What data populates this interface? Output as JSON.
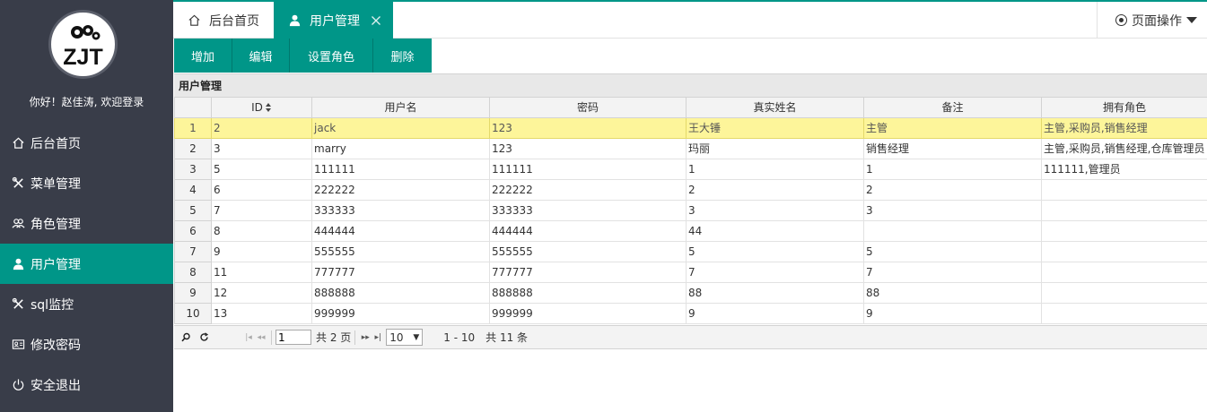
{
  "sidebar": {
    "welcome": "你好！赵佳涛, 欢迎登录",
    "logo_text": "ZJT",
    "items": [
      {
        "label": "后台首页",
        "icon": "home-icon"
      },
      {
        "label": "菜单管理",
        "icon": "tools-icon"
      },
      {
        "label": "角色管理",
        "icon": "users-icon"
      },
      {
        "label": "用户管理",
        "icon": "user-icon",
        "active": true
      },
      {
        "label": "sql监控",
        "icon": "tools-icon"
      },
      {
        "label": "修改密码",
        "icon": "id-card-icon"
      },
      {
        "label": "安全退出",
        "icon": "power-icon"
      }
    ]
  },
  "tabs": {
    "home": "后台首页",
    "user": "用户管理",
    "page_ops": "页面操作"
  },
  "toolbar": {
    "add": "增加",
    "edit": "编辑",
    "set_role": "设置角色",
    "delete": "删除"
  },
  "grid": {
    "title": "用户管理",
    "columns": [
      "ID",
      "用户名",
      "密码",
      "真实姓名",
      "备注",
      "拥有角色"
    ],
    "rows": [
      [
        "1",
        "2",
        "jack",
        "123",
        "王大锤",
        "主管",
        "主管,采购员,销售经理"
      ],
      [
        "2",
        "3",
        "marry",
        "123",
        "玛丽",
        "销售经理",
        "主管,采购员,销售经理,仓库管理员"
      ],
      [
        "3",
        "5",
        "111111",
        "111111",
        "1",
        "1",
        "111111,管理员"
      ],
      [
        "4",
        "6",
        "222222",
        "222222",
        "2",
        "2",
        ""
      ],
      [
        "5",
        "7",
        "333333",
        "333333",
        "3",
        "3",
        ""
      ],
      [
        "6",
        "8",
        "444444",
        "444444",
        "44",
        "",
        ""
      ],
      [
        "7",
        "9",
        "555555",
        "555555",
        "5",
        "5",
        ""
      ],
      [
        "8",
        "11",
        "777777",
        "777777",
        "7",
        "7",
        ""
      ],
      [
        "9",
        "12",
        "888888",
        "888888",
        "88",
        "88",
        ""
      ],
      [
        "10",
        "13",
        "999999",
        "999999",
        "9",
        "9",
        ""
      ]
    ],
    "selected_row": 0
  },
  "pager": {
    "page_value": "1",
    "total_pages": "共 2 页",
    "rows_per_page": "10",
    "range": "1 - 10",
    "total": "共 11 条"
  },
  "colors": {
    "sidebar_bg": "#393d49",
    "accent": "#009688",
    "selected_row": "#fdf59a"
  }
}
